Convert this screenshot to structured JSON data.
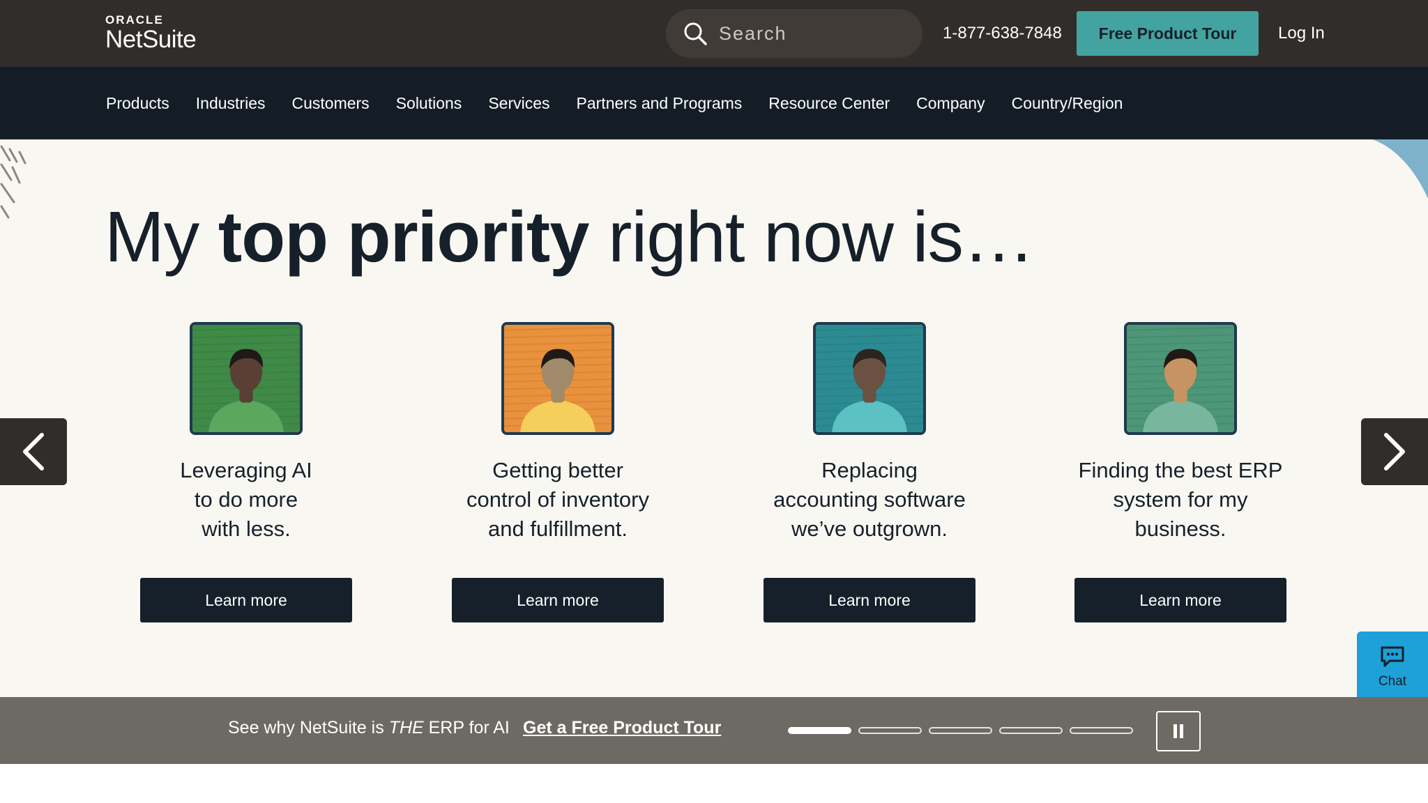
{
  "header": {
    "logo_top": "ORACLE",
    "logo_bottom": "NetSuite",
    "search_placeholder": "Search",
    "phone": "1-877-638-7848",
    "tour_button": "Free Product Tour",
    "login": "Log In"
  },
  "nav": {
    "items": [
      "Products",
      "Industries",
      "Customers",
      "Solutions",
      "Services",
      "Partners and Programs",
      "Resource Center",
      "Company",
      "Country/Region"
    ]
  },
  "hero": {
    "headline_start": "My ",
    "headline_bold": "top priority",
    "headline_end": " right now is…",
    "cards": [
      {
        "line1": "Leveraging AI",
        "line2": "to do more",
        "line3": "with less.",
        "button": "Learn more",
        "bg": "#3f8a47",
        "shirt": "#5aa85e",
        "skin": "#5a4034",
        "hair": "#201915"
      },
      {
        "line1": "Getting better",
        "line2": "control of inventory",
        "line3": "and fulfillment.",
        "button": "Learn more",
        "bg": "#e9913c",
        "shirt": "#f5cf5b",
        "skin": "#a08a6a",
        "hair": "#201915"
      },
      {
        "line1": "Replacing",
        "line2": "accounting software",
        "line3": "we’ve outgrown.",
        "button": "Learn more",
        "bg": "#2c8b92",
        "shirt": "#5cc1c2",
        "skin": "#6b5142",
        "hair": "#2b2520"
      },
      {
        "line1": "Finding the best ERP",
        "line2": "system for my",
        "line3": "business.",
        "button": "Learn more",
        "bg": "#4d9678",
        "shirt": "#78b79e",
        "skin": "#c89363",
        "hair": "#201915"
      }
    ]
  },
  "chat": {
    "label": "Chat"
  },
  "promo": {
    "text_start": "See why NetSuite is ",
    "text_italic": "THE",
    "text_end": " ERP for AI",
    "link": "Get a Free Product Tour",
    "slides_total": 5,
    "active_slide": 1
  },
  "colors": {
    "topbar": "#312d2a",
    "nav": "#141d25",
    "accent": "#43a3a0",
    "hero_bg": "#f9f7f2",
    "button_dark": "#16202a",
    "chat": "#1ea0d8"
  }
}
